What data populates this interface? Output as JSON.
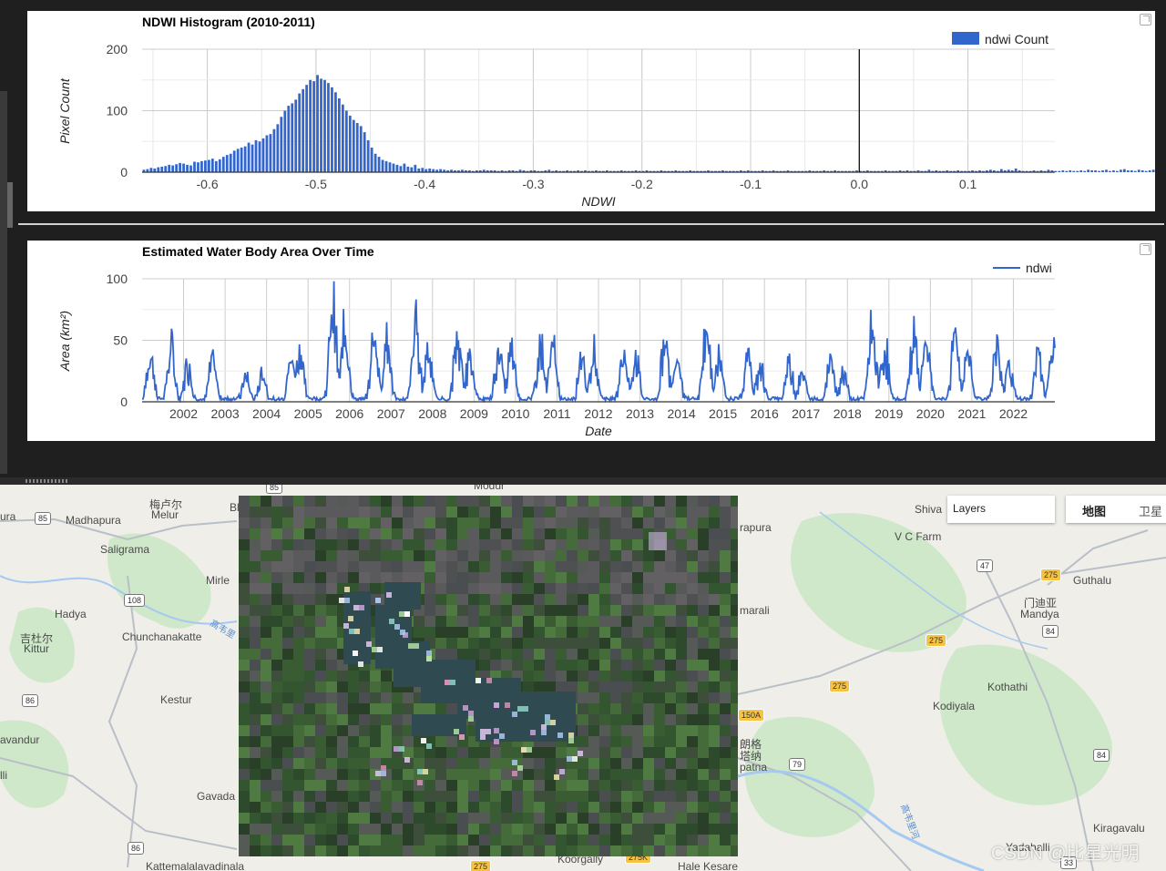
{
  "histogram": {
    "title": "NDWI Histogram (2010-2011)",
    "legend": "ndwi Count",
    "color": "#3366cc",
    "chart_data": {
      "type": "bar",
      "title": "NDWI Histogram (2010-2011)",
      "xlabel": "NDWI",
      "ylabel": "Pixel Count",
      "xlim": [
        -0.66,
        0.18
      ],
      "ylim": [
        0,
        200
      ],
      "xticks": [
        "-0.6",
        "-0.5",
        "-0.4",
        "-0.3",
        "-0.2",
        "-0.1",
        "0.0",
        "0.1"
      ],
      "yticks": [
        "0",
        "100",
        "200"
      ],
      "x_start": -0.66,
      "bin_width": 0.00333,
      "values": [
        4,
        5,
        7,
        6,
        8,
        9,
        10,
        12,
        11,
        13,
        15,
        14,
        12,
        11,
        17,
        16,
        18,
        19,
        20,
        22,
        18,
        21,
        25,
        28,
        30,
        35,
        38,
        40,
        42,
        48,
        45,
        52,
        50,
        55,
        60,
        62,
        70,
        78,
        90,
        100,
        108,
        112,
        118,
        128,
        135,
        142,
        150,
        148,
        158,
        152,
        150,
        145,
        138,
        130,
        120,
        110,
        100,
        92,
        85,
        80,
        75,
        65,
        52,
        40,
        30,
        25,
        20,
        18,
        16,
        14,
        12,
        10,
        14,
        9,
        8,
        12,
        6,
        7,
        5,
        6,
        5,
        4,
        5,
        4,
        3,
        4,
        3,
        3,
        4,
        3,
        3,
        2,
        3,
        3,
        4,
        3,
        3,
        3,
        2,
        3,
        2,
        3,
        3,
        2,
        4,
        3,
        2,
        3,
        3,
        2,
        2,
        3,
        4,
        2,
        3,
        2,
        2,
        3,
        2,
        2,
        3,
        2,
        3,
        2,
        2,
        3,
        2,
        2,
        3,
        2,
        2,
        2,
        3,
        2,
        2,
        2,
        3,
        2,
        2,
        3,
        2,
        2,
        2,
        3,
        2,
        2,
        2,
        3,
        2,
        2,
        2,
        3,
        2,
        2,
        2,
        2,
        3,
        2,
        2,
        2,
        3,
        2,
        2,
        2,
        2,
        3,
        2,
        3,
        2,
        2,
        2,
        3,
        2,
        2,
        3,
        2,
        2,
        2,
        3,
        2,
        2,
        2,
        2,
        2,
        3,
        2,
        2,
        2,
        3,
        2,
        2,
        3,
        2,
        2,
        2,
        2,
        2,
        3,
        2,
        2,
        3,
        2,
        2,
        2,
        2,
        3,
        2,
        2,
        2,
        3,
        2,
        3,
        2,
        2,
        3,
        2,
        2,
        4,
        2,
        3,
        2,
        2,
        3,
        2,
        2,
        3,
        2,
        2,
        2,
        3,
        2,
        3,
        2,
        3,
        4,
        3,
        2,
        5,
        3,
        4,
        3,
        6,
        3,
        2,
        2,
        2,
        3,
        2,
        3,
        2,
        4,
        3,
        2,
        2,
        3,
        2,
        3,
        2,
        2,
        3,
        2,
        4,
        3,
        3,
        2,
        3,
        4,
        2,
        3,
        2,
        4,
        5,
        3,
        3,
        2,
        4,
        3,
        2,
        3,
        4,
        2,
        3,
        2,
        2,
        3,
        2,
        2
      ],
      "vline_x": 0.0
    }
  },
  "timeseries": {
    "title": "Estimated Water Body Area Over Time",
    "legend": "ndwi",
    "color": "#3366cc",
    "chart_data": {
      "type": "line",
      "title": "Estimated Water Body Area Over Time",
      "xlabel": "Date",
      "ylabel": "Area (km²)",
      "ylim": [
        0,
        100
      ],
      "yticks": [
        "0",
        "50",
        "100"
      ],
      "xticks": [
        "2002",
        "2003",
        "2004",
        "2005",
        "2006",
        "2007",
        "2008",
        "2009",
        "2010",
        "2011",
        "2012",
        "2013",
        "2014",
        "2015",
        "2016",
        "2017",
        "2018",
        "2019",
        "2020",
        "2021",
        "2022"
      ],
      "x_range": [
        2001.0,
        2023.0
      ],
      "peaks_by_year": [
        {
          "year": 2001.2,
          "v": 45
        },
        {
          "year": 2001.7,
          "v": 52
        },
        {
          "year": 2002.1,
          "v": 38
        },
        {
          "year": 2002.7,
          "v": 40
        },
        {
          "year": 2003.5,
          "v": 25
        },
        {
          "year": 2003.9,
          "v": 30
        },
        {
          "year": 2004.6,
          "v": 45
        },
        {
          "year": 2004.8,
          "v": 55
        },
        {
          "year": 2005.6,
          "v": 95
        },
        {
          "year": 2005.9,
          "v": 78
        },
        {
          "year": 2006.6,
          "v": 68
        },
        {
          "year": 2006.9,
          "v": 64
        },
        {
          "year": 2007.6,
          "v": 78
        },
        {
          "year": 2007.9,
          "v": 58
        },
        {
          "year": 2008.6,
          "v": 64
        },
        {
          "year": 2008.9,
          "v": 50
        },
        {
          "year": 2009.6,
          "v": 55
        },
        {
          "year": 2009.9,
          "v": 52
        },
        {
          "year": 2010.6,
          "v": 58
        },
        {
          "year": 2010.9,
          "v": 55
        },
        {
          "year": 2011.6,
          "v": 50
        },
        {
          "year": 2011.9,
          "v": 48
        },
        {
          "year": 2012.6,
          "v": 52
        },
        {
          "year": 2012.9,
          "v": 45
        },
        {
          "year": 2013.6,
          "v": 65
        },
        {
          "year": 2013.9,
          "v": 50
        },
        {
          "year": 2014.6,
          "v": 72
        },
        {
          "year": 2014.9,
          "v": 48
        },
        {
          "year": 2015.6,
          "v": 45
        },
        {
          "year": 2015.9,
          "v": 38
        },
        {
          "year": 2016.6,
          "v": 40
        },
        {
          "year": 2016.9,
          "v": 30
        },
        {
          "year": 2017.6,
          "v": 45
        },
        {
          "year": 2017.9,
          "v": 30
        },
        {
          "year": 2018.6,
          "v": 75
        },
        {
          "year": 2018.9,
          "v": 55
        },
        {
          "year": 2019.6,
          "v": 68
        },
        {
          "year": 2019.9,
          "v": 62
        },
        {
          "year": 2020.6,
          "v": 70
        },
        {
          "year": 2020.9,
          "v": 48
        },
        {
          "year": 2021.6,
          "v": 55
        },
        {
          "year": 2021.9,
          "v": 40
        },
        {
          "year": 2022.6,
          "v": 48
        },
        {
          "year": 2022.95,
          "v": 52
        }
      ]
    }
  },
  "map": {
    "layers_label": "Layers",
    "map_type_active": "地图",
    "map_type_other": "卫星",
    "places": [
      {
        "name": "Madhapura"
      },
      {
        "name": "梅卢尔"
      },
      {
        "name": "Melur"
      },
      {
        "name": "Saligrama"
      },
      {
        "name": "Mirle"
      },
      {
        "name": "Hadya"
      },
      {
        "name": "吉杜尔"
      },
      {
        "name": "Kittur"
      },
      {
        "name": "Chunchanakatte"
      },
      {
        "name": "Kestur"
      },
      {
        "name": "avandur"
      },
      {
        "name": "lli"
      },
      {
        "name": "Gavada"
      },
      {
        "name": "Kattemalalavadinala"
      },
      {
        "name": "ura"
      },
      {
        "name": "Shiva"
      },
      {
        "name": "V C Farm"
      },
      {
        "name": "Guthalu"
      },
      {
        "name": "门迪亚"
      },
      {
        "name": "Mandya"
      },
      {
        "name": "Kothathi"
      },
      {
        "name": "Kodiyala"
      },
      {
        "name": "Kiragavalu"
      },
      {
        "name": "Yadahalli"
      },
      {
        "name": "rapura"
      },
      {
        "name": "marali"
      },
      {
        "name": "朗格"
      },
      {
        "name": "塔纳"
      },
      {
        "name": "patna"
      },
      {
        "name": "Hale Kesare"
      },
      {
        "name": "Koorgally"
      },
      {
        "name": "Modur"
      },
      {
        "name": "Bl"
      },
      {
        "name": "高韦里"
      },
      {
        "name": "高韦里河"
      }
    ],
    "roads": [
      "85",
      "85",
      "108",
      "86",
      "86",
      "47",
      "275",
      "84",
      "275",
      "275",
      "150A",
      "79",
      "84",
      "33",
      "275",
      "275K"
    ],
    "watermark": "CSDN @比星光明"
  }
}
